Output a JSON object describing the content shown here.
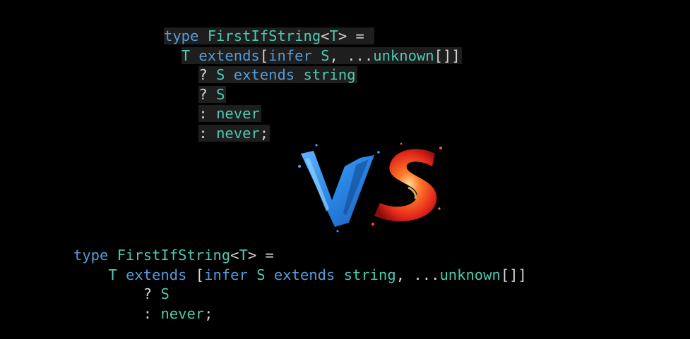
{
  "top_snippet": {
    "lines": [
      {
        "indent": "",
        "tokens": [
          {
            "t": "type",
            "c": "kw"
          },
          {
            "t": " ",
            "c": "pu"
          },
          {
            "t": "FirstIfString",
            "c": "id"
          },
          {
            "t": "<",
            "c": "pu"
          },
          {
            "t": "T",
            "c": "tp"
          },
          {
            "t": "> = ",
            "c": "pu"
          }
        ]
      },
      {
        "indent": "  ",
        "tokens": [
          {
            "t": "T",
            "c": "tp"
          },
          {
            "t": " ",
            "c": "pu"
          },
          {
            "t": "extends",
            "c": "kw"
          },
          {
            "t": "[",
            "c": "pu"
          },
          {
            "t": "infer",
            "c": "kw"
          },
          {
            "t": " ",
            "c": "pu"
          },
          {
            "t": "S",
            "c": "tp"
          },
          {
            "t": ", ...",
            "c": "pu"
          },
          {
            "t": "unknown",
            "c": "ty"
          },
          {
            "t": "[]]",
            "c": "pu"
          }
        ]
      },
      {
        "indent": "    ",
        "tokens": [
          {
            "t": "? ",
            "c": "pu"
          },
          {
            "t": "S",
            "c": "tp"
          },
          {
            "t": " ",
            "c": "pu"
          },
          {
            "t": "extends",
            "c": "kw"
          },
          {
            "t": " ",
            "c": "pu"
          },
          {
            "t": "string",
            "c": "ty"
          }
        ]
      },
      {
        "indent": "    ",
        "tokens": [
          {
            "t": "? ",
            "c": "pu"
          },
          {
            "t": "S",
            "c": "tp"
          }
        ]
      },
      {
        "indent": "    ",
        "tokens": [
          {
            "t": ": ",
            "c": "pu"
          },
          {
            "t": "never",
            "c": "ty"
          }
        ]
      },
      {
        "indent": "    ",
        "tokens": [
          {
            "t": ": ",
            "c": "pu"
          },
          {
            "t": "never",
            "c": "ty"
          },
          {
            "t": ";",
            "c": "pu"
          }
        ]
      }
    ]
  },
  "bottom_snippet": {
    "lines": [
      {
        "indent": "",
        "tokens": [
          {
            "t": "type",
            "c": "kw"
          },
          {
            "t": " ",
            "c": "pu"
          },
          {
            "t": "FirstIfString",
            "c": "id"
          },
          {
            "t": "<",
            "c": "pu"
          },
          {
            "t": "T",
            "c": "tp"
          },
          {
            "t": "> =",
            "c": "pu"
          }
        ]
      },
      {
        "indent": "    ",
        "tokens": [
          {
            "t": "T",
            "c": "tp"
          },
          {
            "t": " ",
            "c": "pu"
          },
          {
            "t": "extends",
            "c": "kw"
          },
          {
            "t": " [",
            "c": "pu"
          },
          {
            "t": "infer",
            "c": "kw"
          },
          {
            "t": " ",
            "c": "pu"
          },
          {
            "t": "S",
            "c": "tp"
          },
          {
            "t": " ",
            "c": "pu"
          },
          {
            "t": "extends",
            "c": "kw"
          },
          {
            "t": " ",
            "c": "pu"
          },
          {
            "t": "string",
            "c": "ty"
          },
          {
            "t": ", ...",
            "c": "pu"
          },
          {
            "t": "unknown",
            "c": "ty"
          },
          {
            "t": "[]]",
            "c": "pu"
          }
        ]
      },
      {
        "indent": "        ",
        "tokens": [
          {
            "t": "? ",
            "c": "pu"
          },
          {
            "t": "S",
            "c": "tp"
          }
        ]
      },
      {
        "indent": "        ",
        "tokens": [
          {
            "t": ": ",
            "c": "pu"
          },
          {
            "t": "never",
            "c": "ty"
          },
          {
            "t": ";",
            "c": "pu"
          }
        ]
      }
    ]
  },
  "vs_logo": {
    "icon": "vs-brush-logo-icon",
    "colors": {
      "v": "#2e8ae6",
      "s": "#e8321c"
    }
  },
  "colors": {
    "background": "#000000",
    "highlight": "#1e1e1e",
    "keyword": "#569cd6",
    "identifier": "#4ec9b0",
    "punctuation": "#d4d4d4"
  }
}
